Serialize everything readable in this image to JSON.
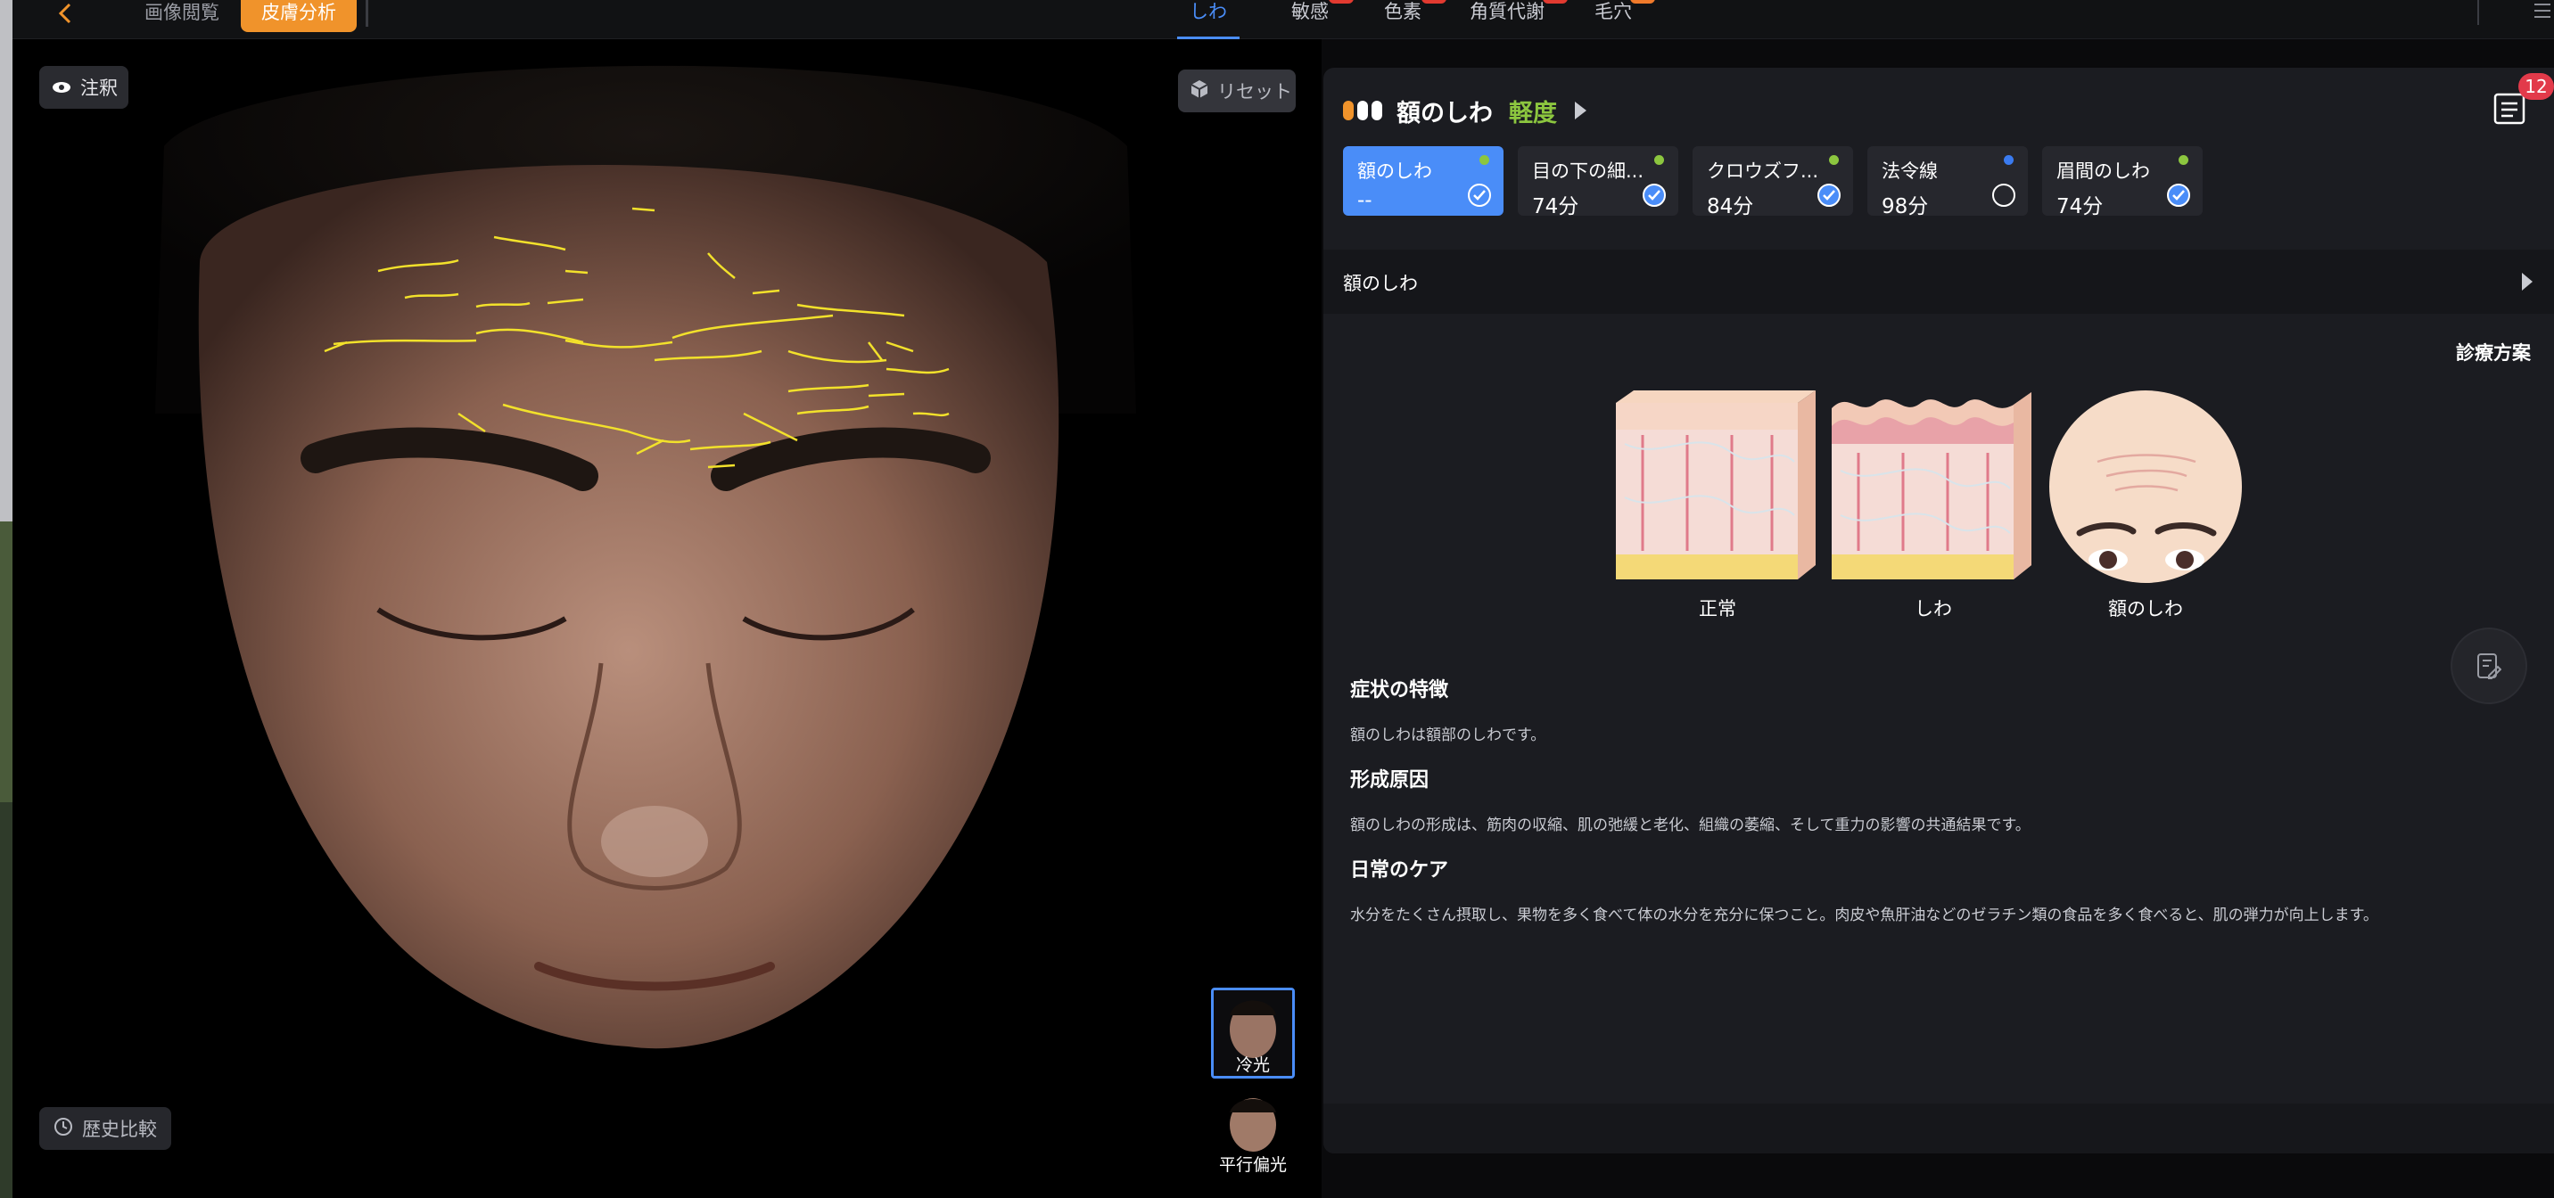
{
  "topbar": {
    "tabs": [
      {
        "label": "画像閲覧",
        "active": false
      },
      {
        "label": "皮膚分析",
        "active": true
      }
    ],
    "categories": [
      {
        "label": "しわ",
        "active": true,
        "badge": ""
      },
      {
        "label": "敏感",
        "active": false,
        "badge": "red"
      },
      {
        "label": "色素",
        "active": false,
        "badge": "red"
      },
      {
        "label": "角質代謝",
        "active": false,
        "badge": "red"
      },
      {
        "label": "毛穴",
        "active": false,
        "badge": "orange"
      }
    ]
  },
  "image_panel": {
    "notes_label": "注釈",
    "reset_label": "リセット",
    "history_label": "歴史比較",
    "thumbnails": [
      {
        "label": "冷光",
        "selected": true
      },
      {
        "label": "平行偏光",
        "selected": false
      }
    ]
  },
  "panel": {
    "region": "額のしわ",
    "severity": "軽度",
    "severity_color": "#8cc63f",
    "report_count": "12",
    "cards": [
      {
        "name": "額のしわ",
        "score": "--",
        "dot_color": "#8cc63f",
        "checked": true,
        "active": true
      },
      {
        "name": "目の下の細...",
        "score": "74分",
        "dot_color": "#8cc63f",
        "checked": true,
        "active": false
      },
      {
        "name": "クロウズフ...",
        "score": "84分",
        "dot_color": "#8cc63f",
        "checked": true,
        "active": false
      },
      {
        "name": "法令線",
        "score": "98分",
        "dot_color": "#3a7bf0",
        "checked": false,
        "active": false
      },
      {
        "name": "眉間のしわ",
        "score": "74分",
        "dot_color": "#8cc63f",
        "checked": true,
        "active": false
      }
    ],
    "section_title": "額のしわ",
    "plan_label": "診療方案",
    "illustrations": [
      {
        "label": "正常"
      },
      {
        "label": "しわ"
      },
      {
        "label": "額のしわ"
      }
    ],
    "info": {
      "symptom_title": "症状の特徴",
      "symptom_text": "額のしわは額部のしわです。",
      "cause_title": "形成原因",
      "cause_text": "額のしわの形成は、筋肉の収縮、肌の弛緩と老化、組織の萎縮、そして重力の影響の共通結果です。",
      "care_title": "日常のケア",
      "care_text": "水分をたくさん摂取し、果物を多く食べて体の水分を充分に保つこと。肉皮や魚肝油などのゼラチン類の食品を多く食べると、肌の弾力が向上します。"
    }
  }
}
